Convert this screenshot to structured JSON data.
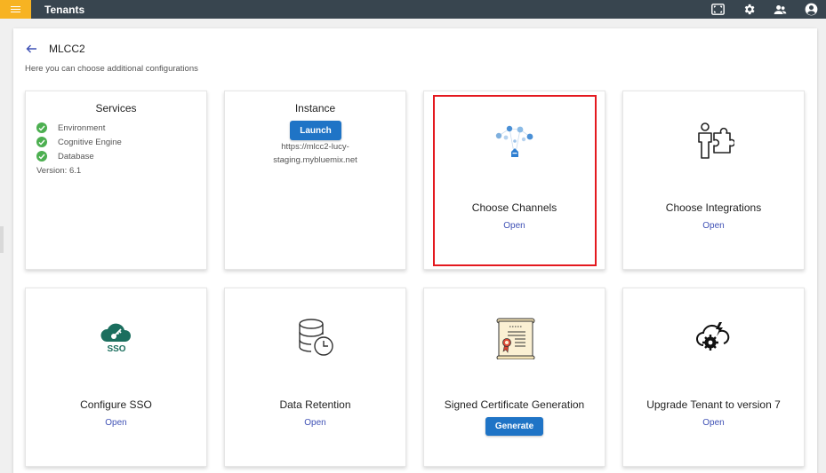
{
  "app": {
    "title": "Tenants"
  },
  "topbar": {
    "icons": [
      "fullscreen-icon",
      "settings-icon",
      "users-icon",
      "account-icon"
    ]
  },
  "page": {
    "title": "MLCC2",
    "subtitle": "Here you can choose additional configurations"
  },
  "cards": {
    "services": {
      "title": "Services",
      "items": [
        "Environment",
        "Cognitive Engine",
        "Database"
      ],
      "version": "Version: 6.1"
    },
    "instance": {
      "title": "Instance",
      "button": "Launch",
      "url_line1": "https://mlcc2-lucy-",
      "url_line2": "staging.mybluemix.net"
    },
    "channels": {
      "title": "Choose Channels",
      "link": "Open"
    },
    "integrations": {
      "title": "Choose Integrations",
      "link": "Open"
    },
    "sso": {
      "title": "Configure SSO",
      "link": "Open",
      "icon_text": "SSO"
    },
    "retention": {
      "title": "Data Retention",
      "link": "Open"
    },
    "certificate": {
      "title": "Signed Certificate Generation",
      "button": "Generate"
    },
    "upgrade": {
      "title": "Upgrade Tenant to version 7",
      "link": "Open"
    }
  },
  "colors": {
    "topbar": "#38454f",
    "menu_accent": "#f7b322",
    "primary_button": "#1f74c6",
    "link": "#3f51b5",
    "check": "#4caf50",
    "sso_icon": "#1b6e5e",
    "highlight": "#e4191f"
  }
}
